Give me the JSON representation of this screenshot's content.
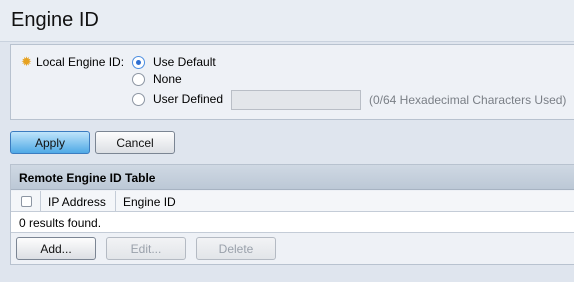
{
  "page": {
    "title": "Engine ID"
  },
  "local_engine": {
    "label": "Local Engine ID:",
    "options": [
      {
        "label": "Use Default",
        "selected": true
      },
      {
        "label": "None",
        "selected": false
      },
      {
        "label": "User Defined",
        "selected": false
      }
    ],
    "input_value": "",
    "hint": "(0/64 Hexadecimal Characters Used)"
  },
  "form_buttons": {
    "apply": "Apply",
    "cancel": "Cancel"
  },
  "remote_table": {
    "title": "Remote Engine ID Table",
    "columns": [
      "IP Address",
      "Engine ID"
    ],
    "empty_message": "0 results found.",
    "buttons": {
      "add": "Add...",
      "edit": "Edit...",
      "delete": "Delete"
    }
  },
  "colors": {
    "required_marker": "#e6a11f",
    "primary_button": "#4fa9e6",
    "radio_selected": "#2f6fd1"
  },
  "icons": {
    "required": "star-icon"
  }
}
